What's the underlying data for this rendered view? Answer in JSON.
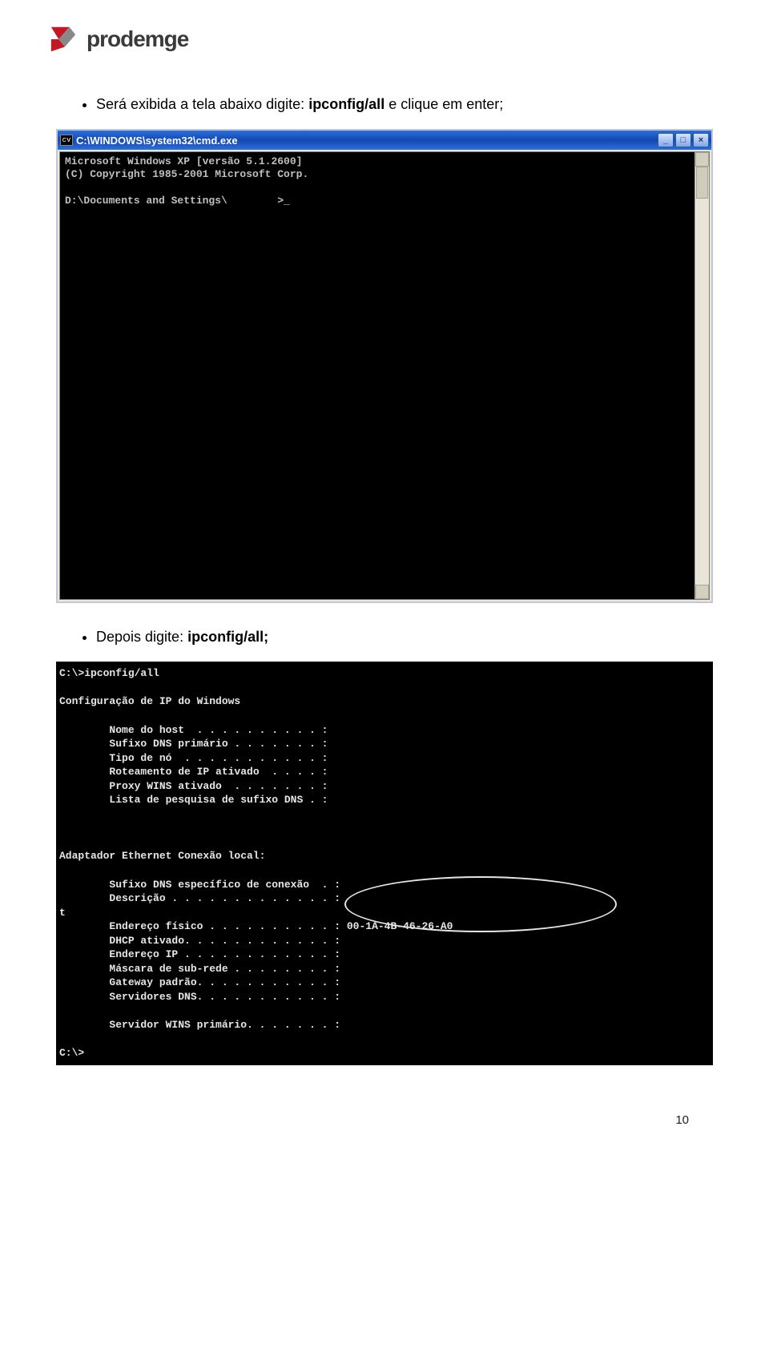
{
  "logo": {
    "brand": "prodemge"
  },
  "bullets": {
    "line1_a": "Será exibida a tela abaixo digite: ",
    "line1_b": "ipconfig/all",
    "line1_c": " e clique em enter;",
    "line2_a": "Depois digite: ",
    "line2_b": "ipconfig/all;"
  },
  "cmd1": {
    "title": "C:\\WINDOWS\\system32\\cmd.exe",
    "icon_label": "cv",
    "btn_min": "_",
    "btn_max": "□",
    "btn_close": "×",
    "text": "Microsoft Windows XP [versão 5.1.2600]\n(C) Copyright 1985-2001 Microsoft Corp.\n\nD:\\Documents and Settings\\        >_"
  },
  "cmd2": {
    "text": "C:\\>ipconfig/all\n\nConfiguração de IP do Windows\n\n        Nome do host  . . . . . . . . . . :\n        Sufixo DNS primário . . . . . . . :\n        Tipo de nó  . . . . . . . . . . . :\n        Roteamento de IP ativado  . . . . :\n        Proxy WINS ativado  . . . . . . . :\n        Lista de pesquisa de sufixo DNS . :\n\n\n\nAdaptador Ethernet Conexão local:\n\n        Sufixo DNS específico de conexão  . :\n        Descrição . . . . . . . . . . . . . :\nt\n        Endereço físico . . . . . . . . . . : 00-1A-4B-46-26-A0\n        DHCP ativado. . . . . . . . . . . . :\n        Endereço IP . . . . . . . . . . . . :\n        Máscara de sub-rede . . . . . . . . :\n        Gateway padrão. . . . . . . . . . . :\n        Servidores DNS. . . . . . . . . . . :\n\n        Servidor WINS primário. . . . . . . :\n\nC:\\>"
  },
  "page_number": "10"
}
